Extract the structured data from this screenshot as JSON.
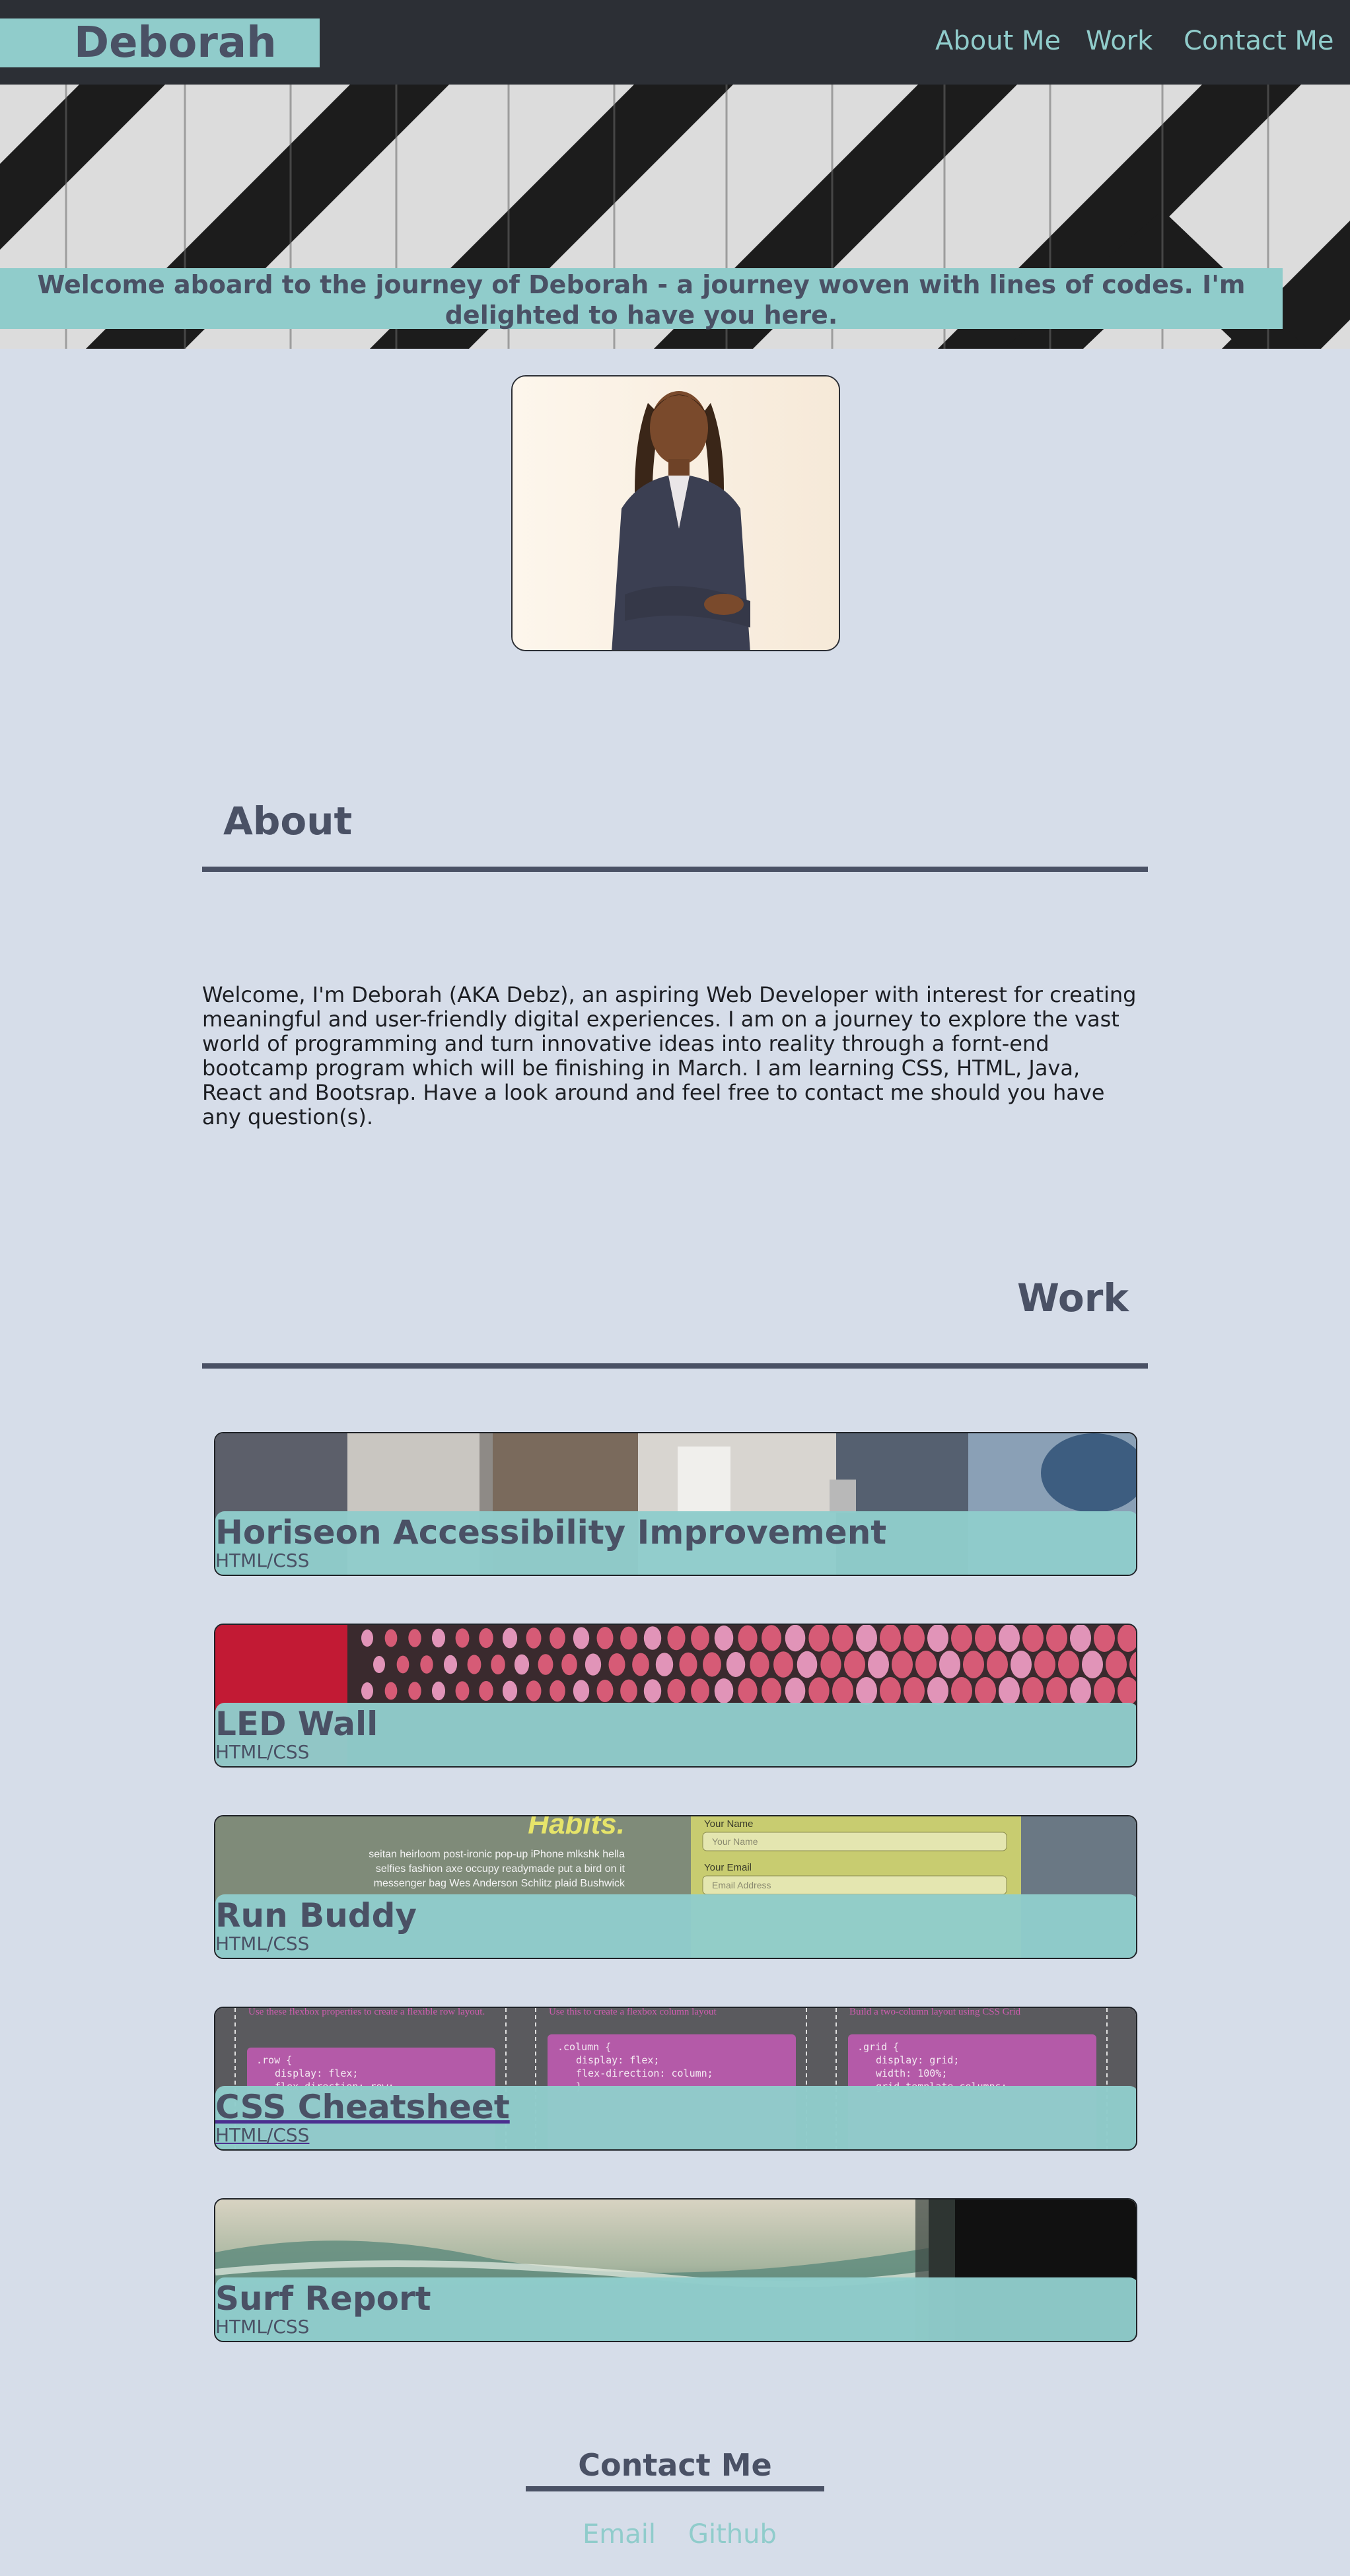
{
  "nav": {
    "brand": "Deborah",
    "links": [
      "About Me",
      "Work",
      "Contact Me"
    ]
  },
  "hero": {
    "banner": "Welcome aboard to the journey of Deborah - a journey woven with lines of codes. I'm delighted to have you here."
  },
  "about": {
    "title": "About",
    "text": "Welcome, I'm Deborah (AKA Debz), an aspiring Web Developer with interest for creating meaningful and user-friendly digital experiences. I am on a journey to explore the vast world of programming and turn innovative ideas into reality through a fornt-end bootcamp program which will be finishing in March. I am learning CSS, HTML, Java, React and Bootsrap. Have a look around and feel free to contact me should you have any question(s)."
  },
  "work": {
    "title": "Work",
    "projects": [
      {
        "title": "Horiseon Accessibility Improvement",
        "tech": "HTML/CSS"
      },
      {
        "title": "LED Wall",
        "tech": "HTML/CSS"
      },
      {
        "title": "Run Buddy",
        "tech": "HTML/CSS"
      },
      {
        "title": "CSS Cheatsheet",
        "tech": "HTML/CSS"
      },
      {
        "title": "Surf Report",
        "tech": "HTML/CSS"
      }
    ],
    "preview_text": {
      "runbuddy_heading": "Habits.",
      "runbuddy_body_1": "seitan heirloom post-ironic pop-up iPhone mlkshk hella",
      "runbuddy_body_2": "selfies fashion axe occupy readymade put a bird on it",
      "runbuddy_body_3": "messenger bag Wes Anderson Schlitz plaid Bushwick",
      "runbuddy_name_label": "Your Name",
      "runbuddy_name_placeholder": "Your Name",
      "runbuddy_email_label": "Your Email",
      "runbuddy_email_placeholder": "Email Address",
      "cheat_col1_head": "Use these flexbox properties to create a flexible row layout.",
      "cheat_col2_head": "Use this to create a flexbox column layout",
      "cheat_col3_head": "Build a two-column layout using CSS Grid",
      "cheat_code1": [
        ".row {",
        "display: flex;",
        "flex-direction: row;"
      ],
      "cheat_code2": [
        ".column {",
        "display: flex;",
        "flex-direction: column;",
        "}"
      ],
      "cheat_code3": [
        ".grid {",
        "display: grid;",
        "width: 100%;",
        "grid-template-columns:"
      ]
    }
  },
  "contact": {
    "title": "Contact Me",
    "links": [
      "Email",
      "Github"
    ]
  },
  "colors": {
    "navbar_bg": "#2c2f35",
    "accent_teal": "#90cccb",
    "heading_slate": "#4a5165",
    "page_bg": "#d6dde9"
  }
}
